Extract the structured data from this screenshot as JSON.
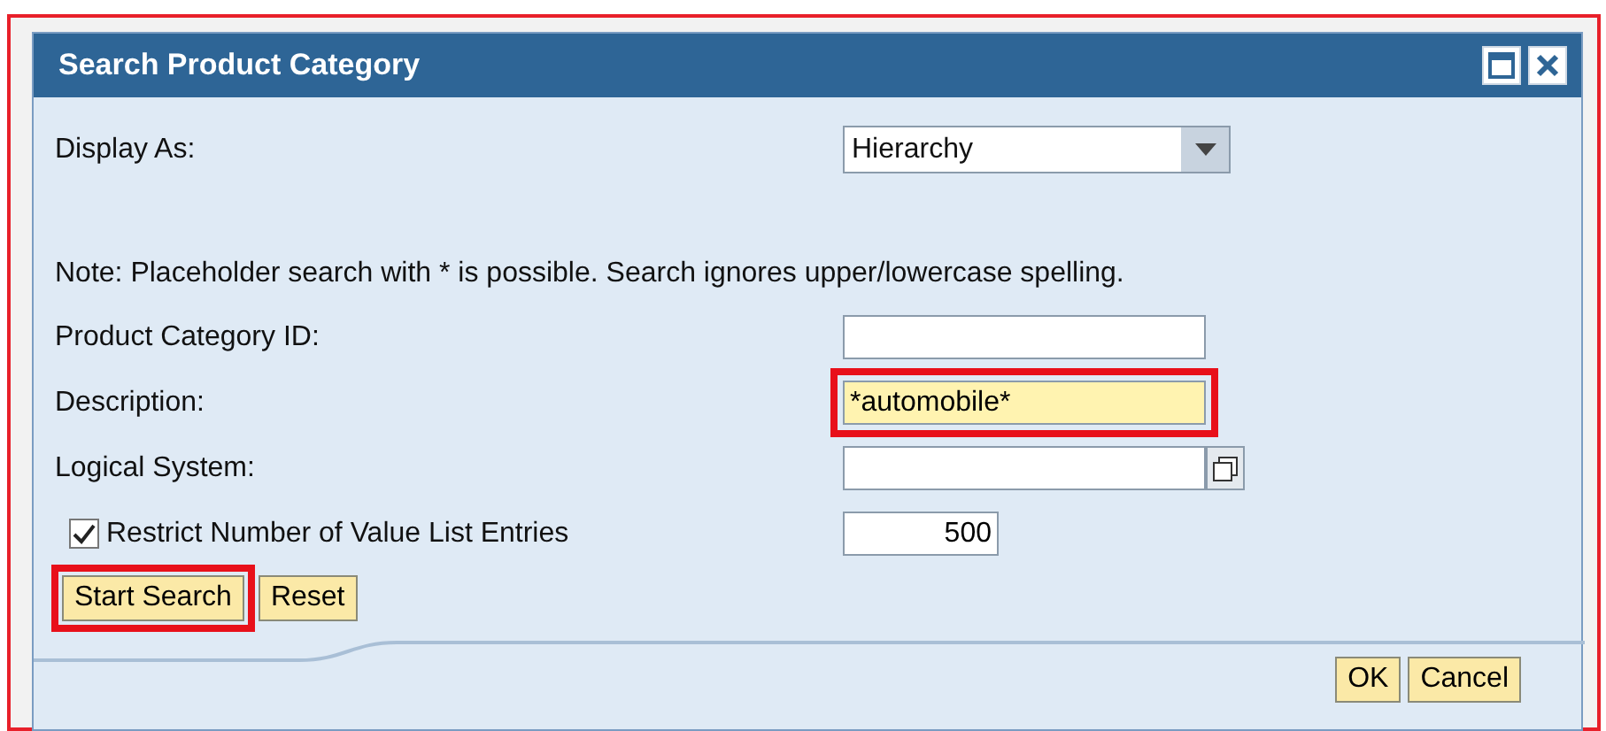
{
  "window": {
    "title": "Search Product Category"
  },
  "display_as": {
    "label": "Display As:",
    "value": "Hierarchy"
  },
  "note": "Note: Placeholder search with * is possible. Search ignores upper/lowercase spelling.",
  "fields": [
    {
      "label": "Product Category ID:",
      "kind": "text",
      "highlighted": false
    },
    {
      "label": "Description:",
      "value": "*automobile*",
      "kind": "text",
      "highlighted": true
    },
    {
      "label": "Logical System:",
      "kind": "lookup",
      "highlighted": false
    }
  ],
  "restrict": {
    "label": "Restrict Number of Value List Entries",
    "checked": true,
    "value": "500"
  },
  "actions": [
    {
      "label": "Start Search",
      "highlighted": true
    },
    {
      "label": "Reset",
      "highlighted": false
    }
  ],
  "footer_buttons": [
    "OK",
    "Cancel"
  ]
}
